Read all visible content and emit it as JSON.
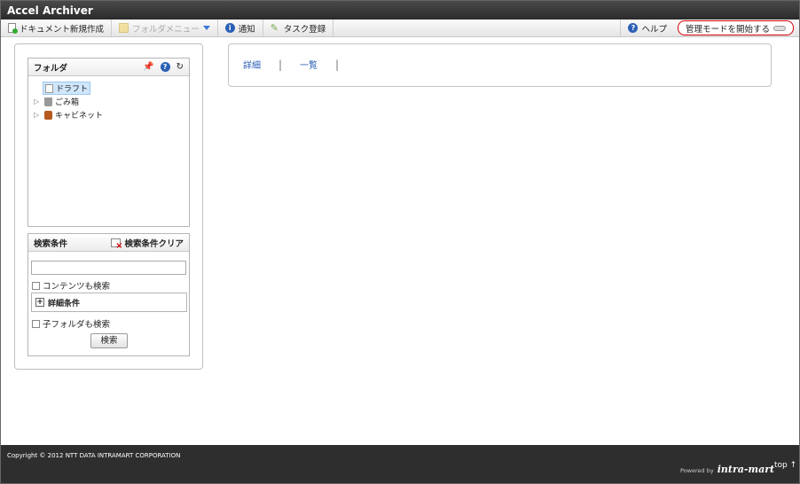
{
  "app": {
    "title": "Accel Archiver"
  },
  "toolbar": {
    "new_document": "ドキュメント新規作成",
    "folder_menu": "フォルダメニュー",
    "notice": "通知",
    "task_register": "タスク登録",
    "help": "ヘルプ",
    "admin_mode": "管理モードを開始する"
  },
  "folder_panel": {
    "title": "フォルダ",
    "tree": [
      {
        "label": "ドラフト",
        "icon": "draft-icon",
        "selected": true
      },
      {
        "label": "ごみ箱",
        "icon": "trash-icon"
      },
      {
        "label": "キャビネット",
        "icon": "cabinet-icon"
      }
    ]
  },
  "search_panel": {
    "title": "検索条件",
    "clear": "検索条件クリア",
    "keyword_value": "",
    "search_content": "コンテンツも検索",
    "detail": "詳細条件",
    "search_subfolders": "子フォルダも検索",
    "search_button": "検索"
  },
  "view": {
    "detail": "詳細",
    "list": "一覧"
  },
  "footer": {
    "copyright": "Copyright © 2012 NTT DATA INTRAMART CORPORATION",
    "powered_by": "Powered by",
    "brand": "intra-mart",
    "top": "top ↑"
  },
  "colors": {
    "titlebar": "#2b2b2b",
    "link": "#2a5fb5",
    "admin_border": "#d40000",
    "footer": "#2e2e2e"
  }
}
